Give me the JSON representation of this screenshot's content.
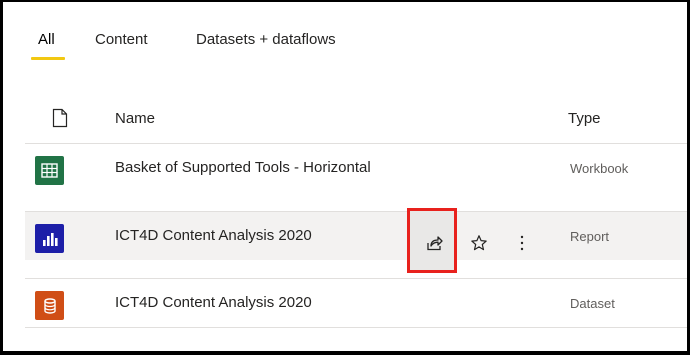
{
  "tabs": [
    {
      "label": "All",
      "active": true
    },
    {
      "label": "Content",
      "active": false
    },
    {
      "label": "Datasets + dataflows",
      "active": false
    }
  ],
  "table": {
    "header": {
      "name": "Name",
      "type": "Type",
      "icon": "file-icon"
    },
    "rows": [
      {
        "name": "Basket of Supported Tools - Horizontal",
        "type": "Workbook",
        "icon": "excel-workbook-icon",
        "color": "#217346"
      },
      {
        "name": "ICT4D Content Analysis 2020",
        "type": "Report",
        "icon": "report-bar-chart-icon",
        "color": "#1d1fa8",
        "actions": [
          "share-icon",
          "star-icon",
          "more-options-icon"
        ]
      },
      {
        "name": "ICT4D Content Analysis 2020",
        "type": "Dataset",
        "icon": "dataset-database-icon",
        "color": "#d04e16"
      }
    ]
  },
  "highlight_color": "#e8211d",
  "accent": "#f2c811"
}
